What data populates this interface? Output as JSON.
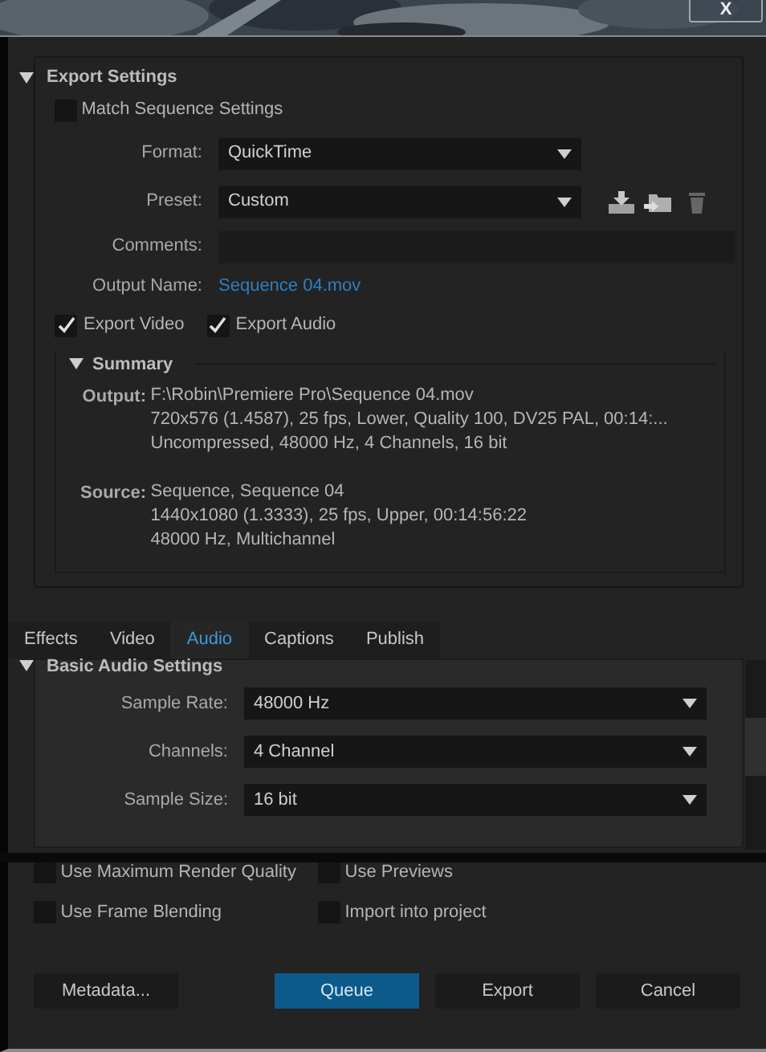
{
  "close_button": {
    "label": "X"
  },
  "export_settings": {
    "title": "Export Settings",
    "expanded": true,
    "match_sequence": {
      "label": "Match Sequence Settings",
      "checked": false
    },
    "format": {
      "label": "Format:",
      "value": "QuickTime"
    },
    "preset": {
      "label": "Preset:",
      "value": "Custom"
    },
    "comments": {
      "label": "Comments:"
    },
    "output_name": {
      "label": "Output Name:",
      "value": "Sequence 04.mov"
    },
    "export_checks": [
      {
        "label": "Export Video",
        "checked": true
      },
      {
        "label": "Export Audio",
        "checked": true
      }
    ],
    "summary": {
      "title": "Summary",
      "expanded": true,
      "entries": [
        {
          "label": "Output:",
          "lines": [
            "F:\\Robin\\Premiere Pro\\Sequence 04.mov",
            "720x576 (1.4587), 25 fps, Lower, Quality 100, DV25 PAL, 00:14:...",
            "Uncompressed, 48000 Hz, 4 Channels, 16 bit"
          ]
        },
        {
          "label": "Source:",
          "lines": [
            "Sequence, Sequence 04",
            "1440x1080 (1.3333), 25 fps, Upper, 00:14:56:22",
            "48000 Hz, Multichannel"
          ]
        }
      ]
    }
  },
  "tabs": [
    {
      "label": "Effects",
      "selected": false
    },
    {
      "label": "Video",
      "selected": false
    },
    {
      "label": "Audio",
      "selected": true
    },
    {
      "label": "Captions",
      "selected": false
    },
    {
      "label": "Publish",
      "selected": false
    }
  ],
  "audio_settings": {
    "title": "Basic Audio Settings",
    "expanded": true,
    "fields": [
      {
        "label": "Sample Rate:",
        "value": "48000 Hz"
      },
      {
        "label": "Channels:",
        "value": "4 Channel"
      },
      {
        "label": "Sample Size:",
        "value": "16 bit"
      }
    ]
  },
  "options": [
    {
      "label": "Use Maximum Render Quality",
      "checked": false
    },
    {
      "label": "Use Previews",
      "checked": false
    },
    {
      "label": "Use Frame Blending",
      "checked": false
    },
    {
      "label": "Import into project",
      "checked": false
    }
  ],
  "buttons": [
    {
      "label": "Metadata...",
      "kind": "plain"
    },
    {
      "label": "Queue",
      "kind": "primary"
    },
    {
      "label": "Export",
      "kind": "plain"
    },
    {
      "label": "Cancel",
      "kind": "plain"
    }
  ]
}
